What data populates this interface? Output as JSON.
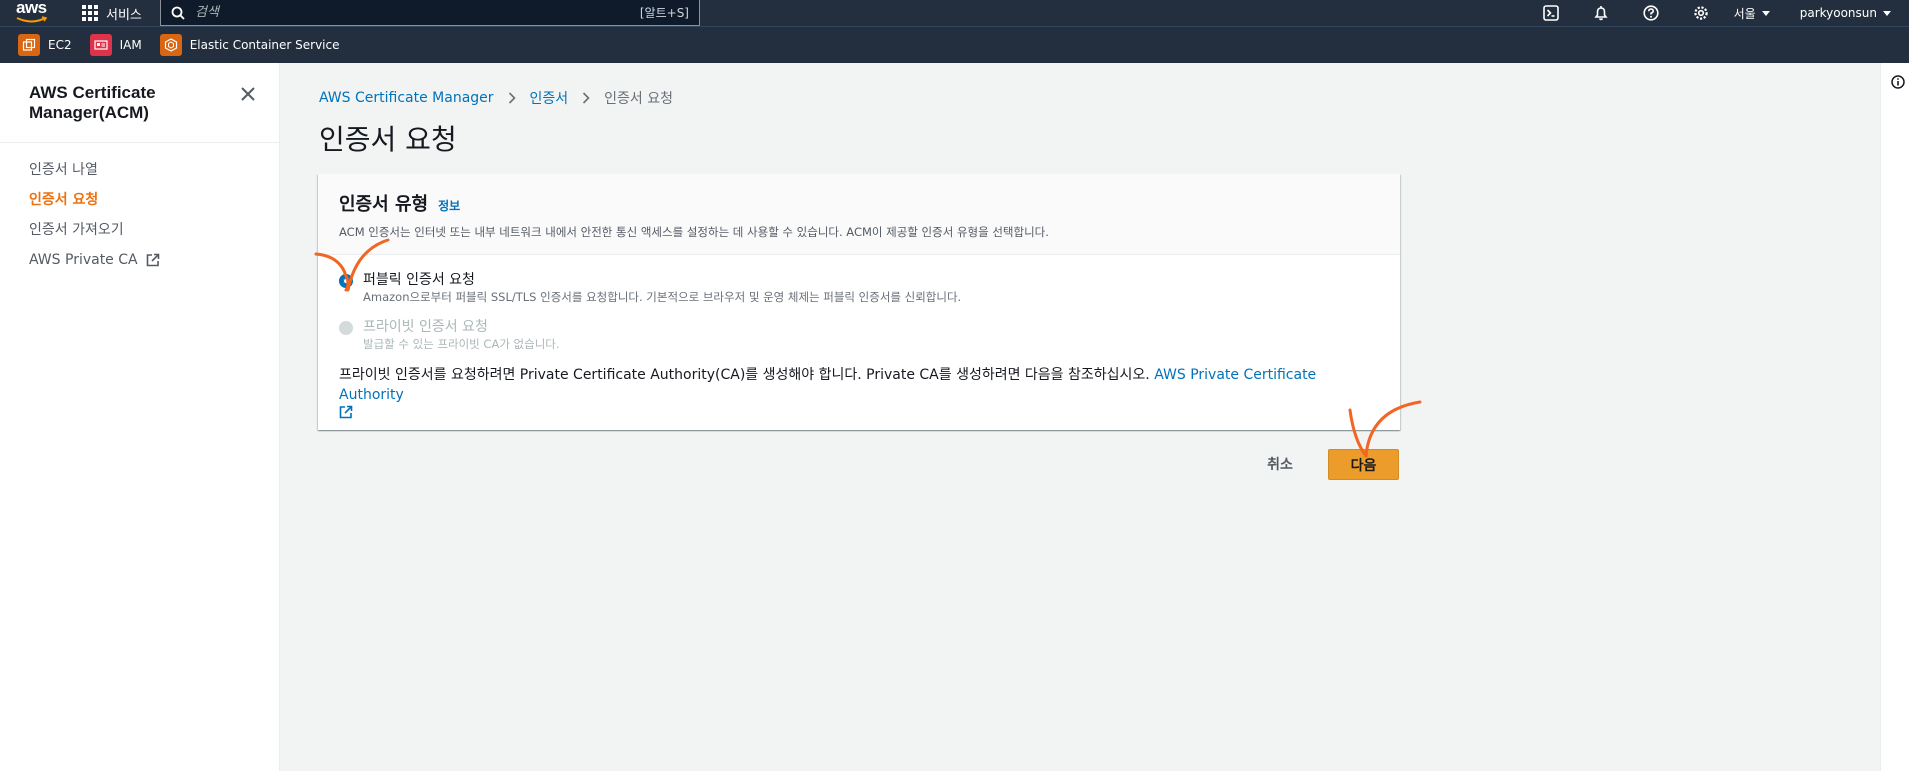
{
  "topnav": {
    "logo_text": "aws",
    "services_label": "서비스",
    "search_placeholder": "검색",
    "search_shortcut": "[알트+S]",
    "region": "서울",
    "user": "parkyoonsun"
  },
  "favorites": [
    {
      "label": "EC2",
      "icon": "ec2-icon"
    },
    {
      "label": "IAM",
      "icon": "iam-icon"
    },
    {
      "label": "Elastic Container Service",
      "icon": "ecs-icon"
    }
  ],
  "sidebar": {
    "title": "AWS Certificate Manager(ACM)",
    "items": [
      {
        "label": "인증서 나열"
      },
      {
        "label": "인증서 요청"
      },
      {
        "label": "인증서 가져오기"
      },
      {
        "label": "AWS Private CA"
      }
    ]
  },
  "breadcrumb": {
    "root": "AWS Certificate Manager",
    "mid": "인증서",
    "current": "인증서 요청"
  },
  "page": {
    "title": "인증서 요청"
  },
  "card": {
    "title": "인증서 유형",
    "info": "정보",
    "desc": "ACM 인증서는 인터넷 또는 내부 네트워크 내에서 안전한 통신 액세스를 설정하는 데 사용할 수 있습니다. ACM이 제공할 인증서 유형을 선택합니다.",
    "options": [
      {
        "label": "퍼블릭 인증서 요청",
        "desc": "Amazon으로부터 퍼블릭 SSL/TLS 인증서를 요청합니다. 기본적으로 브라우저 및 운영 체제는 퍼블릭 인증서를 신뢰합니다."
      },
      {
        "label": "프라이빗 인증서 요청",
        "desc": "발급할 수 있는 프라이빗 CA가 없습니다."
      }
    ],
    "note_text": "프라이빗 인증서를 요청하려면 Private Certificate Authority(CA)를 생성해야 합니다. Private CA를 생성하려면 다음을 참조하십시오. ",
    "note_link": "AWS Private Certificate Authority"
  },
  "actions": {
    "cancel": "취소",
    "next": "다음"
  },
  "colors": {
    "nav_bg": "#232f3e",
    "accent": "#ec7211",
    "link": "#0073bb",
    "primary_btn": "#ec9c2a",
    "annotation": "#f26522"
  }
}
